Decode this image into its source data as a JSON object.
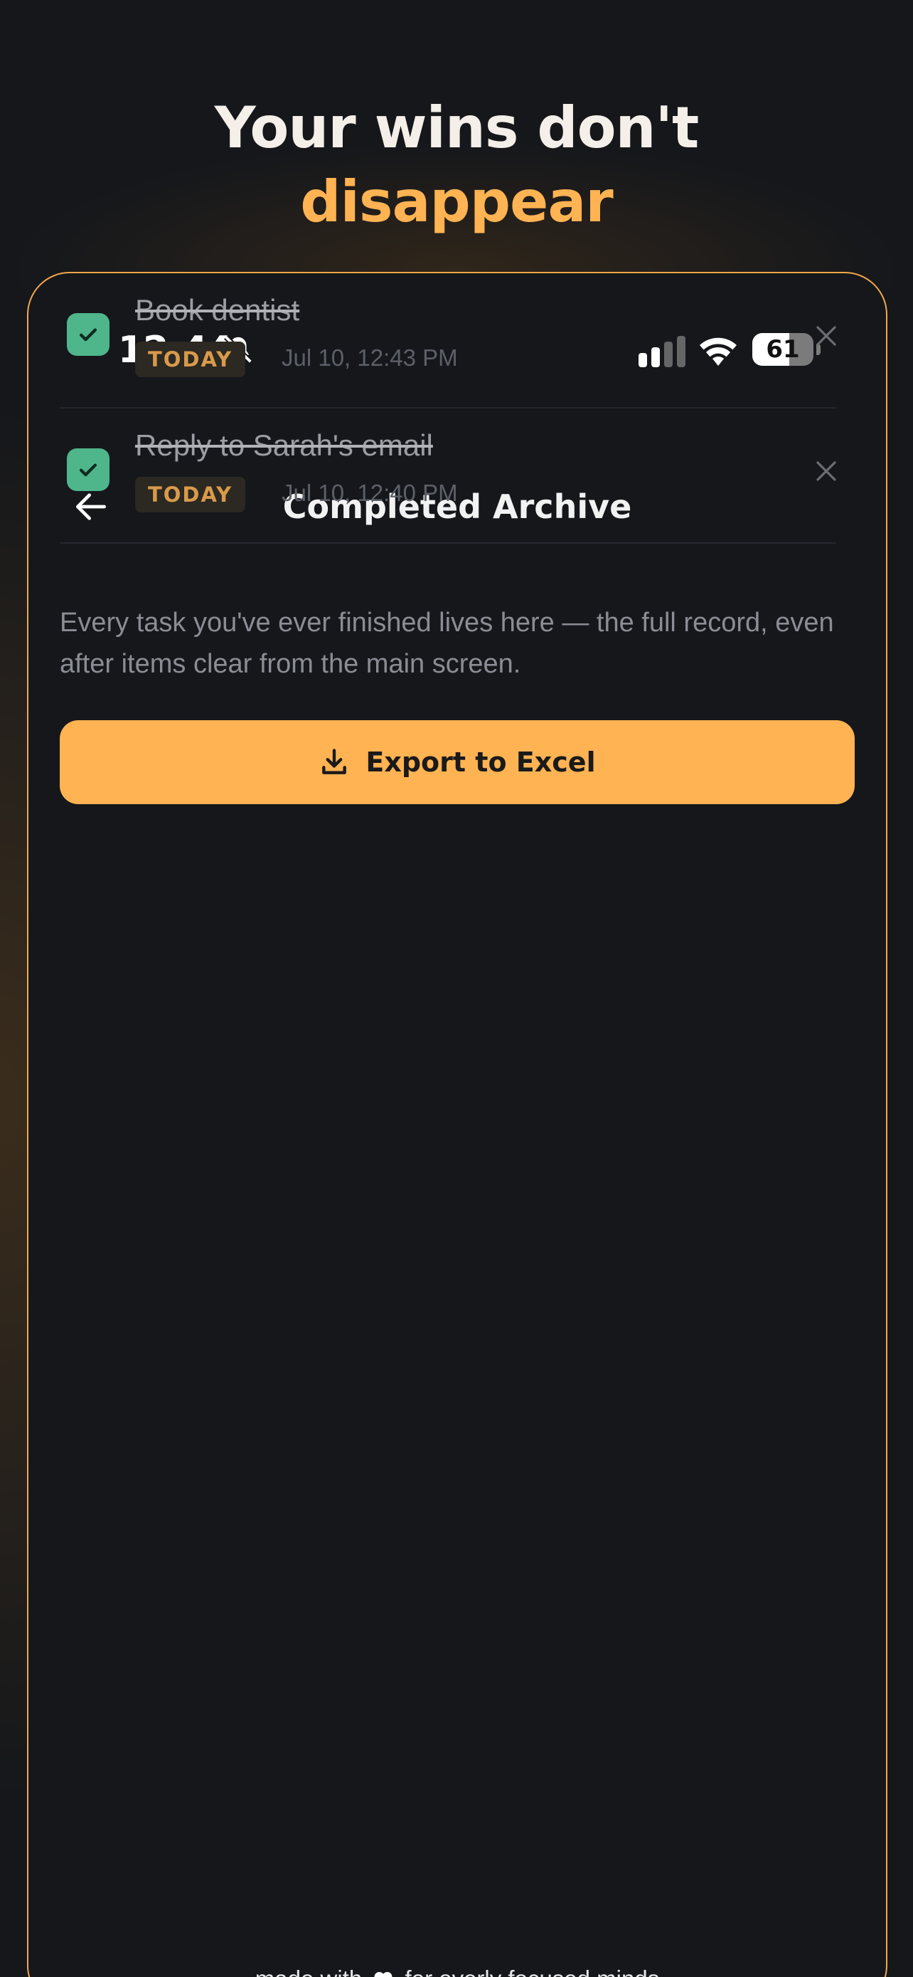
{
  "headline": {
    "line1": "Your wins don't",
    "line2": "disappear"
  },
  "status_bar": {
    "time": "12:44",
    "battery": "61",
    "battery_level": 0.61
  },
  "screen": {
    "title": "Completed Archive",
    "description": "Every task you've ever finished lives here — the full record, even after items clear from the main screen.",
    "export_label": "Export to Excel"
  },
  "tasks": [
    {
      "title": "Book dentist",
      "badge": "TODAY",
      "timestamp": "Jul 10, 12:43 PM"
    },
    {
      "title": "Reply to Sarah's email",
      "badge": "TODAY",
      "timestamp": "Jul 10, 12:40 PM"
    }
  ],
  "footer": {
    "before": "made with",
    "after": "for overly focused minds"
  },
  "colors": {
    "accent": "#ffb352",
    "check": "#4fb58a",
    "background": "#15171b"
  }
}
